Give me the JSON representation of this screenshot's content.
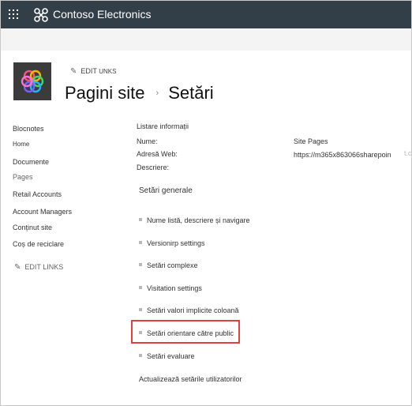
{
  "suite_bar": {
    "app_name": "Contoso Electronics",
    "colors": {
      "background": "#333f48",
      "text": "#ffffff"
    }
  },
  "header": {
    "edit_links": {
      "first": "EDIT",
      "second": "UNKS"
    },
    "breadcrumb": {
      "parent": "Pagini site",
      "separator": "›",
      "current": "Setări"
    }
  },
  "left_nav": {
    "items": [
      {
        "label": "Blocnotes"
      },
      {
        "label": "Home"
      },
      {
        "label": "Documente"
      },
      {
        "label": "Pages"
      },
      {
        "label": "Retail Accounts"
      },
      {
        "label": "Account Managers"
      },
      {
        "label": "Conținut site"
      },
      {
        "label": "Coș de reciclare"
      }
    ],
    "edit_links": "EDIT LINKS"
  },
  "list_info": {
    "title": "Listare informații",
    "name_label": "Nume:",
    "name_value": "Site Pages",
    "address_label": "Adresă Web:",
    "address_value": "https://m365x863066sharepoin",
    "address_overflow": "t.co",
    "description_label": "Descriere:"
  },
  "general_settings": {
    "title": "Setări generale",
    "items": [
      {
        "label": "Nume listă, descriere și navigare"
      },
      {
        "label": "Versionirp settings"
      },
      {
        "label": "Setări complexe"
      },
      {
        "label": "Visitation settings"
      },
      {
        "label": "Setări valori implicite coloană"
      },
      {
        "label": "Setări orientare către public"
      },
      {
        "label": "Setări evaluare"
      }
    ],
    "highlighted_index": 5,
    "highlight_color": "#e43e3e"
  },
  "update_user_settings": "Actualizează setările utilizatorilor"
}
